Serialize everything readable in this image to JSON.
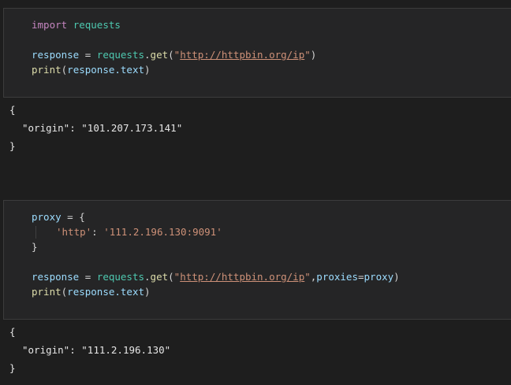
{
  "cell1": {
    "lines": {
      "l1": {
        "kw": "import",
        "module": "requests"
      },
      "l2": {
        "var": "response",
        "eq": " = ",
        "obj": "requests",
        "dot": ".",
        "fn": "get",
        "open": "(",
        "q1": "\"",
        "url": "http://httpbin.org/ip",
        "q2": "\"",
        "close": ")"
      },
      "l3": {
        "fn": "print",
        "open": "(",
        "arg": "response.text",
        "close": ")"
      }
    }
  },
  "output1": {
    "open": "{",
    "key": "\"origin\"",
    "colon": ": ",
    "value": "\"101.207.173.141\"",
    "close": "}"
  },
  "cell2": {
    "lines": {
      "l1": {
        "var": "proxy",
        "eq": " = ",
        "brace": "{"
      },
      "l2": {
        "key": "'http'",
        "colon": ": ",
        "value": "'111.2.196.130:9091'"
      },
      "l3": {
        "brace": "}"
      },
      "l4": {
        "var": "response",
        "eq": " = ",
        "obj": "requests",
        "dot": ".",
        "fn": "get",
        "open": "(",
        "q1": "\"",
        "url": "http://httpbin.org/ip",
        "q2": "\"",
        "comma": ",",
        "kwarg": "proxies",
        "eq2": "=",
        "kwval": "proxy",
        "close": ")"
      },
      "l5": {
        "fn": "print",
        "open": "(",
        "arg": "response.text",
        "close": ")"
      }
    }
  },
  "output2": {
    "open": "{",
    "key": "\"origin\"",
    "colon": ": ",
    "value": "\"111.2.196.130\"",
    "close": "}"
  }
}
